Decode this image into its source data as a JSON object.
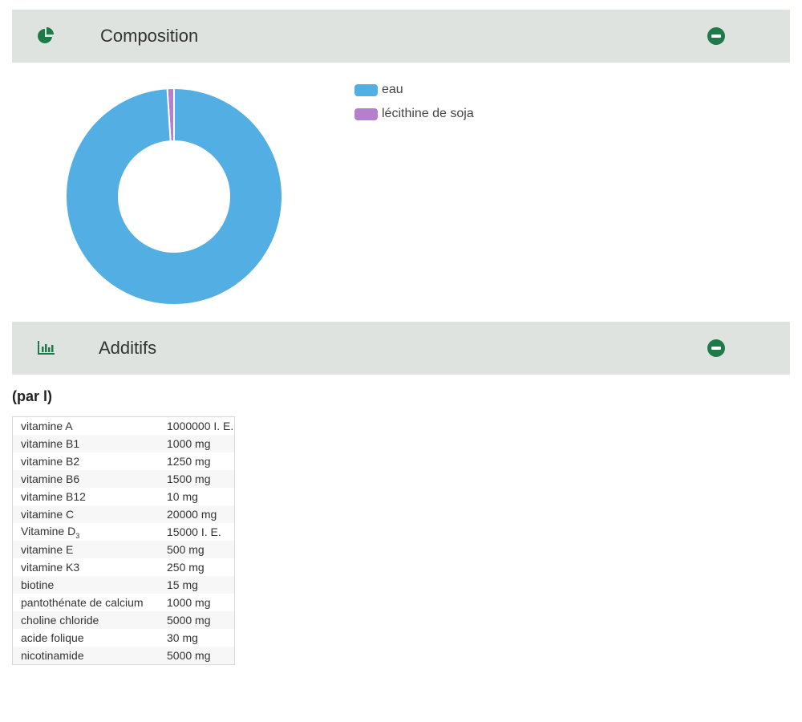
{
  "composition": {
    "title": "Composition",
    "icon": "pie-chart-icon",
    "collapse_icon": "minus-circle-icon"
  },
  "chart_data": {
    "type": "pie",
    "donut": true,
    "categories": [
      "eau",
      "lécithine de soja"
    ],
    "values": [
      99,
      1
    ],
    "colors": [
      "#53aee3",
      "#b47fcb"
    ],
    "legend_position": "right"
  },
  "additifs": {
    "title": "Additifs",
    "icon": "bar-chart-icon",
    "collapse_icon": "minus-circle-icon",
    "unit_label": "(par l)",
    "rows": [
      {
        "name": "vitamine A",
        "value": "1000000 I. E."
      },
      {
        "name": "vitamine B1",
        "value": "1000 mg"
      },
      {
        "name": "vitamine B2",
        "value": "1250 mg"
      },
      {
        "name": "vitamine B6",
        "value": "1500 mg"
      },
      {
        "name": "vitamine B12",
        "value": "10 mg"
      },
      {
        "name": "vitamine C",
        "value": "20000 mg"
      },
      {
        "name": "Vitamine D",
        "value": "15000 I. E.",
        "sub": "3"
      },
      {
        "name": "vitamine E",
        "value": "500 mg"
      },
      {
        "name": "vitamine K3",
        "value": "250 mg"
      },
      {
        "name": "biotine",
        "value": "15 mg"
      },
      {
        "name": "pantothénate de calcium",
        "value": "1000 mg"
      },
      {
        "name": "choline chloride",
        "value": "5000 mg"
      },
      {
        "name": "acide folique",
        "value": "30 mg"
      },
      {
        "name": "nicotinamide",
        "value": "5000 mg"
      }
    ]
  },
  "colors": {
    "header_bg": "#dfe3df",
    "icon_green": "#1e7a46"
  }
}
